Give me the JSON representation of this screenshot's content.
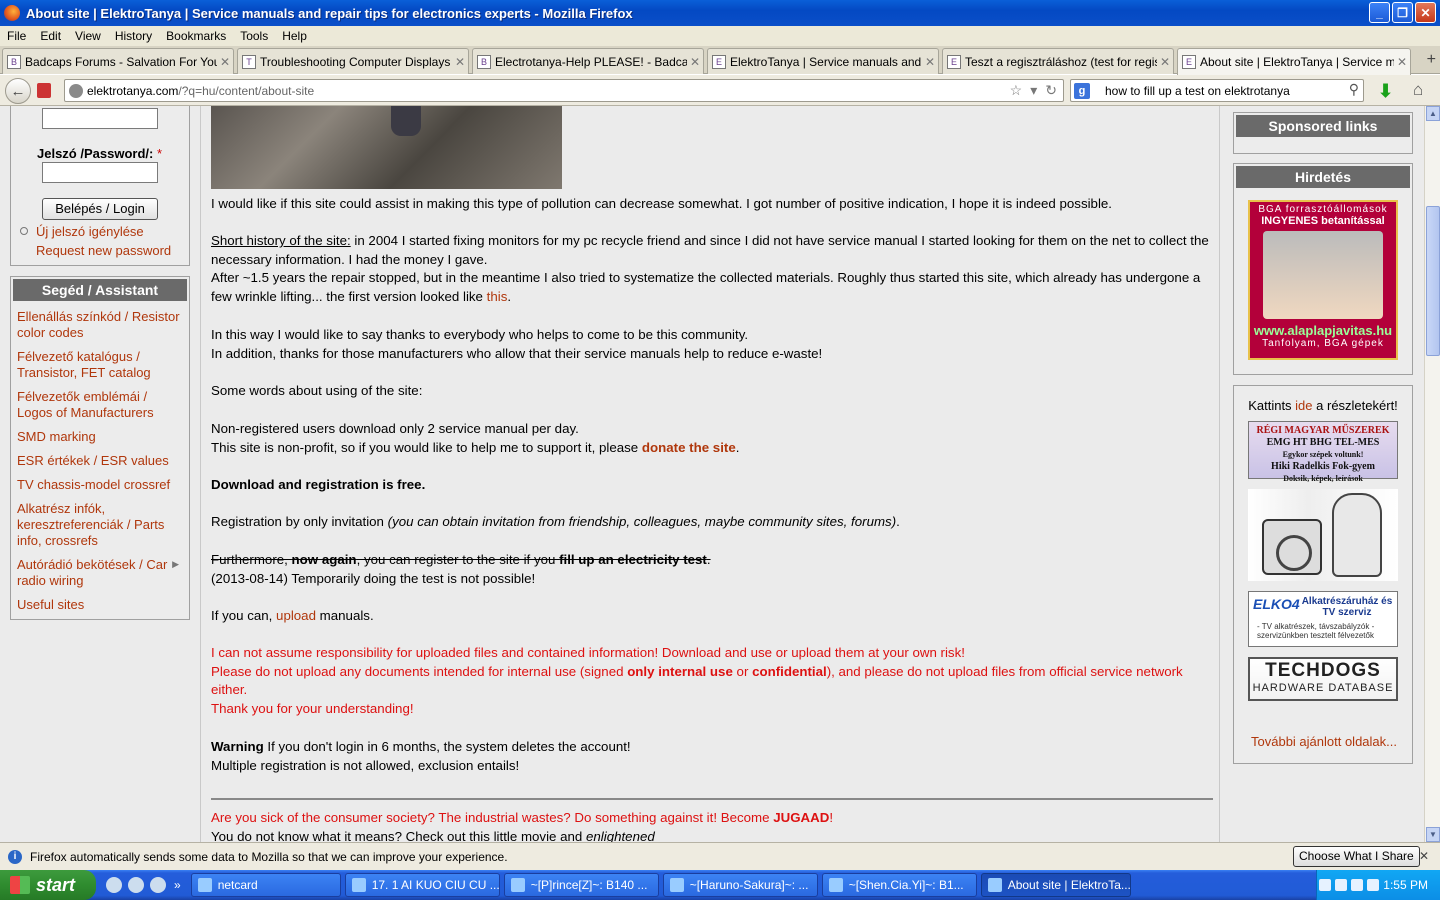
{
  "window": {
    "title": "About site | ElektroTanya | Service manuals and repair tips for electronics experts - Mozilla Firefox",
    "buttons": {
      "min": "_",
      "max": "❐",
      "close": "✕"
    }
  },
  "menu": [
    "File",
    "Edit",
    "View",
    "History",
    "Bookmarks",
    "Tools",
    "Help"
  ],
  "tabs": [
    {
      "label": "Badcaps Forums - Salvation For Your ...",
      "icon": "B"
    },
    {
      "label": "Troubleshooting Computer Displays - ...",
      "icon": "T"
    },
    {
      "label": "Electrotanya-Help PLEASE! - Badcaps ...",
      "icon": "B"
    },
    {
      "label": "ElektroTanya | Service manuals and r...",
      "icon": "E"
    },
    {
      "label": "Teszt a regisztráláshoz (test for regist...",
      "icon": "E"
    },
    {
      "label": "About site | ElektroTanya | Service m...",
      "icon": "E"
    }
  ],
  "nav": {
    "url_host": "elektrotanya.com",
    "url_path": "/?q=hu/content/about-site",
    "search_value": "how to fill up a test on elektrotanya"
  },
  "left": {
    "password_label": "Jelszó /Password/: ",
    "required_mark": "*",
    "login_button": "Belépés / Login",
    "new_password": "Új jelszó igénylése",
    "request_password": "Request new password",
    "assist_title": "Segéd / Assistant",
    "assist_items": [
      "Ellenállás színkód / Resistor color codes",
      "Félvezető katalógus / Transistor, FET catalog",
      "Félvezetők emblémái / Logos of Manufacturers",
      "SMD marking",
      "ESR értékek / ESR values",
      "TV chassis-model crossref",
      "Alkatrész infók, keresztreferenciák / Parts info, crossrefs",
      "Autórádió bekötések / Car radio wiring",
      "Useful sites"
    ]
  },
  "main": {
    "p1": "I would like if this site could assist in making this type of pollution can decrease somewhat. I got number of positive indication, I hope it is indeed possible.",
    "history_label": "Short history of the site:",
    "history_text": " in 2004 I started fixing monitors for my pc recycle friend and since I did not have service manual I started looking for them on the net to collect the necessary information. I had the money I gave.",
    "history2": "After ~1.5 years the repair stopped, but in the meantime I also tried to systematize the collected materials. Roughly thus started this site, which already has undergone a few wrinkle lifting... the first version looked like ",
    "this_link": "this",
    "thanks1": "In this way I would like to say thanks to everybody who helps to come to be this community.",
    "thanks2": "In addition, thanks for those manufacturers who allow that their service manuals help to reduce e-waste!",
    "some_words": "Some words about using of the site:",
    "nonreg": "Non-registered users download only 2 service manual per day.",
    "nonprofit": "This site is non-profit, so if you would like to help me to support it, please ",
    "donate": "donate the site",
    "free": "Download and registration is free.",
    "reg_by": "Registration by only invitation ",
    "reg_italic": "(you can obtain invitation from friendship, colleagues, maybe community sites, forums)",
    "furthermore": "Furthermore, ",
    "now_again": "now again",
    "register_text": ", you can register to the site if you ",
    "fill_test": "fill up an electricity test",
    "temp": "(2013-08-14) Temporarily doing the test is not possible!",
    "if_you_can": "If you can, ",
    "upload": "upload",
    "manuals": " manuals.",
    "resp": "I can not assume responsibility for uploaded files and contained information! Download and use or upload them at your own risk!",
    "please1": "Please do not upload any documents intended for internal use (signed ",
    "internal": "only internal use",
    "or": " or ",
    "confidential": "confidential",
    "please2": "), and please do not upload files from official service network either.",
    "thankyou": "Thank you for your understanding!",
    "warning": "Warning",
    "warning_text": " If you don't login in 6 months, the system deletes the account!",
    "multiple": "Multiple registration is not allowed, exclusion entails!",
    "sick": "Are you sick of the consumer society? The industrial wastes? Do something against it! Become ",
    "jugaad": "JUGAAD",
    "bang": "!",
    "movie": "You do not know what it means? Check out this little movie and ",
    "enlightened": "enlightened"
  },
  "right": {
    "sponsored": "Sponsored links",
    "hirdetes": "Hirdetés",
    "ad1_line1": "BGA forrasztóállomások",
    "ad1_line2": "INGYENES betanítással",
    "ad1_site": "www.alaplapjavitas.hu",
    "ad1_line3": "Tanfolyam, BGA gépek",
    "kattints": "Kattints ",
    "ide": "ide",
    "reszletek": " a részletekért!",
    "muszer1": "RÉGI MAGYAR MŰSZEREK",
    "muszer2": "EMG  HT  BHG  TEL-MES",
    "muszer3": "Egykor szépek voltunk!",
    "muszer4": "Hiki   Radelkis   Fok-gyem",
    "muszer5": "Doksik, képek, leírások",
    "elko_logo": "ELKO4",
    "elko1": "Alkatrészáruház és TV szerviz",
    "elko2": "- TV alkatrészek, távszabályzók - szervizünkben tesztelt félvezetők",
    "techdogs1": "TECHDOGS",
    "techdogs2": "HARDWARE DATABASE",
    "tovabbi": "További ajánlott oldalak..."
  },
  "notification": {
    "text": "Firefox automatically sends some data to Mozilla so that we can improve your experience.",
    "button": "Choose What I Share",
    "close": "✕"
  },
  "taskbar": {
    "start": "start",
    "tasks": [
      "netcard",
      "17. 1 AI KUO CIU CU ...",
      "~[P]rince[Z]~:  B140 ...",
      "~[Haruno-Sakura]~: ...",
      "~[Shen.Cia.Yi]~:  B1...",
      "About site | ElektroTa..."
    ],
    "time": "1:55 PM"
  }
}
